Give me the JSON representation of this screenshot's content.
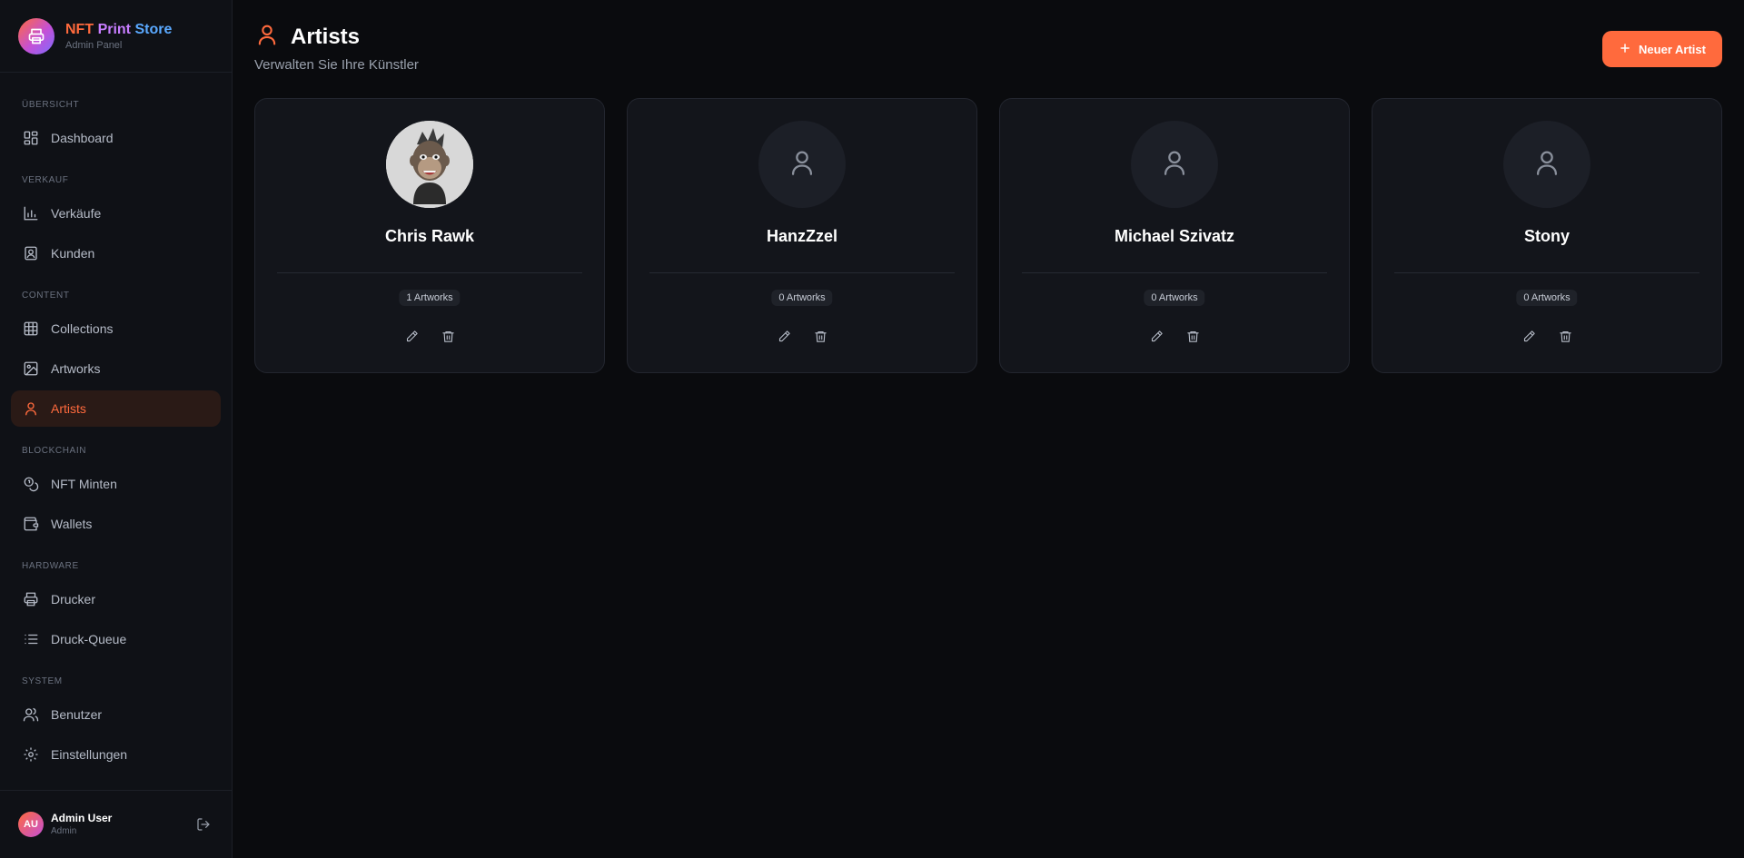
{
  "brand": {
    "title_part1": "NFT",
    "title_part2": "Print",
    "title_part3": "Store",
    "subtitle": "Admin Panel"
  },
  "sidebar": {
    "sections": [
      {
        "label": "ÜBERSICHT"
      },
      {
        "label": "VERKAUF"
      },
      {
        "label": "CONTENT"
      },
      {
        "label": "BLOCKCHAIN"
      },
      {
        "label": "HARDWARE"
      },
      {
        "label": "SYSTEM"
      }
    ],
    "items": [
      {
        "label": "Dashboard",
        "icon": "dashboard-icon"
      },
      {
        "label": "Verkäufe",
        "icon": "bar-chart-icon"
      },
      {
        "label": "Kunden",
        "icon": "contact-card-icon"
      },
      {
        "label": "Collections",
        "icon": "grid-icon"
      },
      {
        "label": "Artworks",
        "icon": "image-icon"
      },
      {
        "label": "Artists",
        "icon": "user-icon",
        "active": true
      },
      {
        "label": "NFT Minten",
        "icon": "coins-icon"
      },
      {
        "label": "Wallets",
        "icon": "wallet-icon"
      },
      {
        "label": "Drucker",
        "icon": "printer-icon"
      },
      {
        "label": "Druck-Queue",
        "icon": "list-icon"
      },
      {
        "label": "Benutzer",
        "icon": "users-icon"
      },
      {
        "label": "Einstellungen",
        "icon": "gear-icon"
      }
    ]
  },
  "user": {
    "initials": "AU",
    "name": "Admin User",
    "role": "Admin"
  },
  "header": {
    "title": "Artists",
    "subtitle": "Verwalten Sie Ihre Künstler",
    "new_button": "Neuer Artist"
  },
  "artists": [
    {
      "name": "Chris Rawk",
      "count": "1 Artworks",
      "has_photo": true
    },
    {
      "name": "HanzZzel",
      "count": "0 Artworks",
      "has_photo": false
    },
    {
      "name": "Michael Szivatz",
      "count": "0 Artworks",
      "has_photo": false
    },
    {
      "name": "Stony",
      "count": "0 Artworks",
      "has_photo": false
    }
  ],
  "colors": {
    "accent": "#ff6a3d",
    "background": "#0a0b0e",
    "sidebar": "#0f1116",
    "card": "#13151b"
  }
}
